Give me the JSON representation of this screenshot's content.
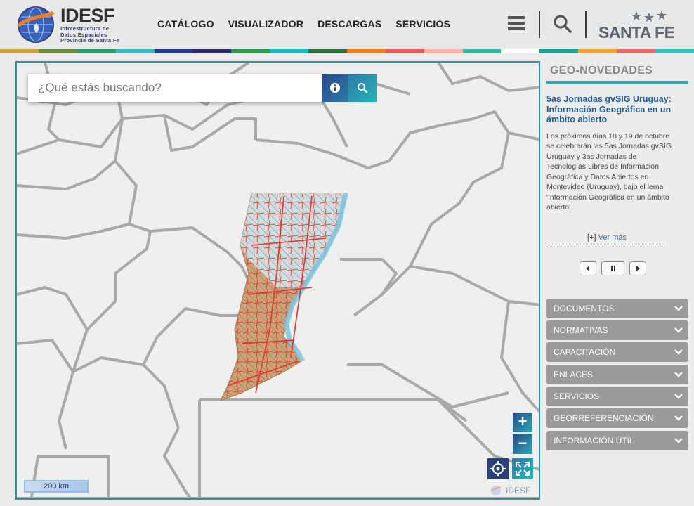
{
  "header": {
    "logo_title": "IDESF",
    "logo_sub_1": "Infraestructura de",
    "logo_sub_2": "Datos Espaciales",
    "logo_sub_3": "Provincia de Santa Fe",
    "nav": [
      "CATÁLOGO",
      "VISUALIZADOR",
      "DESCARGAS",
      "SERVICIOS"
    ],
    "brand": "SANTA FE"
  },
  "stripe_colors": [
    "#c8a236",
    "#6c8d3d",
    "#2e9c6a",
    "#3bb8c4",
    "#263e8f",
    "#2b2b6b",
    "#2c9c4f",
    "#18b8c9",
    "#2a6f3d",
    "#ef7f1a",
    "#e85a55",
    "#ffb2a8",
    "#2fb6a0",
    "#ffffff",
    "#1fa296",
    "#f3a62b",
    "#e76b6b",
    "#2fc3bf"
  ],
  "map": {
    "search_placeholder": "¿Qué estás buscando?",
    "zoom_in": "+",
    "zoom_out": "−",
    "scale_label": "200 km",
    "credit": "IDESF"
  },
  "panel": {
    "title": "GEO-NOVEDADES",
    "news_title": "5as Jornadas gvSIG Uruguay: Información Geográfica en un ámbito abierto",
    "news_body": "Los próximos días 18 y 19 de octubre se celebrarán las 5as Jornadas gvSIG Uruguay y 3as Jornadas de Tecnologías Libres de Información Geográfica y Datos Abiertos en Montevideo (Uruguay), bajo el lema 'Información Geográfica en un ámbito abierto'.",
    "see_more_prefix": "[+]",
    "see_more": "Ver más",
    "accordion": [
      "DOCUMENTOS",
      "NORMATIVAS",
      "CAPACITACIÓN",
      "ENLACES",
      "SERVICIOS",
      "GEORREFERENCIACIÓN",
      "INFORMACIÓN ÚTIL"
    ]
  }
}
